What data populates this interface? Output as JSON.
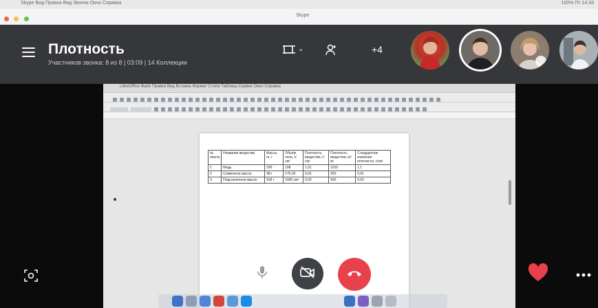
{
  "window": {
    "menubar_text": "Skype  Вид  Правка  Вид  Звонок  Окно  Справка",
    "menubar_right": "100%  Пт 14:33",
    "tab_title": "Skype"
  },
  "call": {
    "title": "Плотность",
    "subtitle": "Участников звонка: 8 из 8 | 03:09 | 14 Коллекции",
    "more_participants": "+4",
    "accent_color": "#e8414c"
  },
  "shared_screen": {
    "app_menu": "LibreOffice  Файл  Правка  Вид  Вставка  Формат  Стили  Таблица  Сервис  Окно  Справка",
    "table": {
      "headers": [
        "№ опыта",
        "Название вещества",
        "Масса, m, г",
        "Объём тела, V, см³",
        "Плотность вещества, г/см³",
        "Плотность вещества, кг/м³",
        "Стандартное значение плотности, г/см³"
      ],
      "rows": [
        [
          "1",
          "Медь",
          "200",
          "198",
          "1,01",
          "1010",
          "1,1"
        ],
        [
          "2",
          "Сливочное масло",
          "98 г",
          "170,20",
          "0,91",
          "920",
          "0,91"
        ],
        [
          "3",
          "Подсолнечное масло",
          "918 г",
          "1000 см³",
          "0,92",
          "920",
          "0,93"
        ]
      ]
    }
  }
}
